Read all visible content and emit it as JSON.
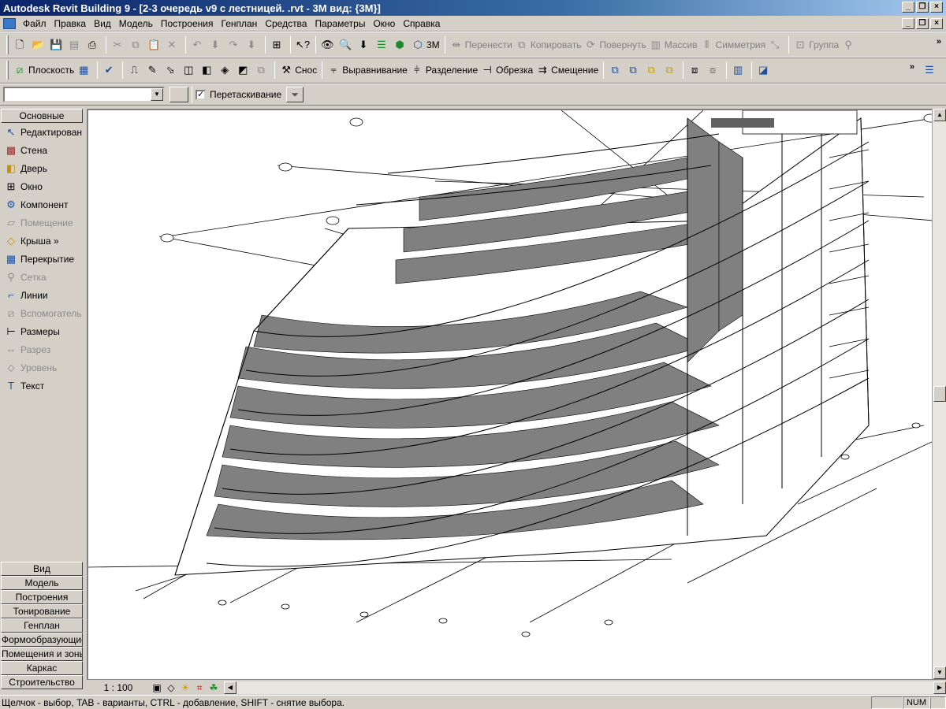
{
  "window": {
    "title": "Autodesk Revit Building 9 - [2-3 очередь v9 с лестницей. .rvt - 3М вид: {3М}]"
  },
  "menu": [
    "Файл",
    "Правка",
    "Вид",
    "Модель",
    "Построения",
    "Генплан",
    "Средства",
    "Параметры",
    "Окно",
    "Справка"
  ],
  "toolbar1": {
    "view_3d": "3М",
    "move": "Перенести",
    "copy": "Копировать",
    "rotate": "Повернуть",
    "array": "Массив",
    "mirror": "Симметрия",
    "group": "Группа"
  },
  "toolbar2": {
    "plane": "Плоскость",
    "demolish": "Снос",
    "align": "Выравнивание",
    "split": "Разделение",
    "trim": "Обрезка",
    "offset": "Смещение"
  },
  "options_bar": {
    "type_selector": "",
    "drag_label": "Перетаскивание",
    "drag_checked": "✓"
  },
  "palette": {
    "active_tab": "Основные",
    "items": [
      {
        "label": "Редактирован",
        "icon": "pointer-icon",
        "disabled": false
      },
      {
        "label": "Стена",
        "icon": "wall-icon",
        "disabled": false
      },
      {
        "label": "Дверь",
        "icon": "door-icon",
        "disabled": false
      },
      {
        "label": "Окно",
        "icon": "window-icon",
        "disabled": false
      },
      {
        "label": "Компонент",
        "icon": "component-icon",
        "disabled": false
      },
      {
        "label": "Помещение",
        "icon": "room-icon",
        "disabled": true
      },
      {
        "label": "Крыша »",
        "icon": "roof-icon",
        "disabled": false
      },
      {
        "label": "Перекрытие",
        "icon": "floor-icon",
        "disabled": false
      },
      {
        "label": "Сетка",
        "icon": "grid-icon",
        "disabled": true
      },
      {
        "label": "Линии",
        "icon": "lines-icon",
        "disabled": false
      },
      {
        "label": "Вспомогатель",
        "icon": "ref-plane-icon",
        "disabled": true
      },
      {
        "label": "Размеры",
        "icon": "dimension-icon",
        "disabled": false
      },
      {
        "label": "Разрез",
        "icon": "section-icon",
        "disabled": true
      },
      {
        "label": "Уровень",
        "icon": "level-icon",
        "disabled": true
      },
      {
        "label": "Текст",
        "icon": "text-icon",
        "disabled": false
      }
    ],
    "tabs": [
      "Вид",
      "Модель",
      "Построения",
      "Тонирование",
      "Генплан",
      "Формообразующие",
      "Помещения и зоны",
      "Каркас",
      "Строительство"
    ]
  },
  "viewbar": {
    "scale": "1 : 100"
  },
  "status": {
    "text": "Щелчок - выбор, TAB - варианты, CTRL - добавление, SHIFT - снятие выбора.",
    "num": "NUM"
  }
}
